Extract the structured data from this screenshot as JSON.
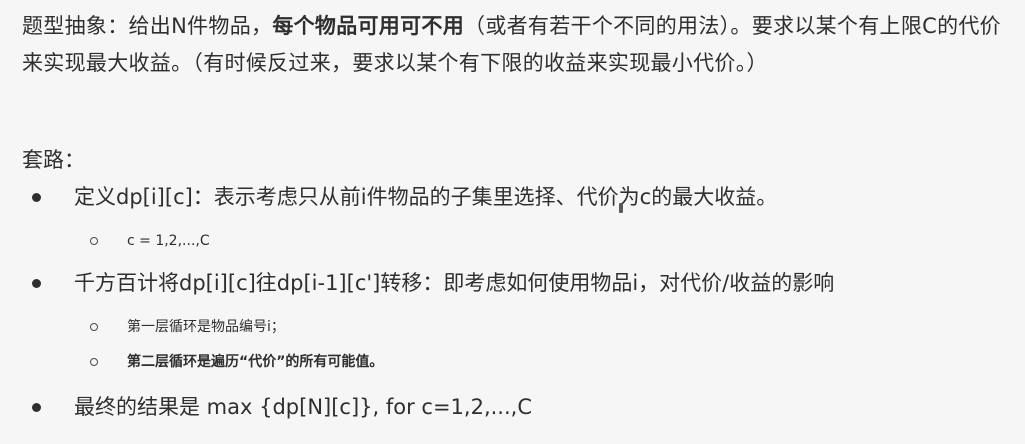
{
  "intro": {
    "part1": "题型抽象：给出N件物品，",
    "bold": "每个物品可用可不用",
    "part2": "（或者有若干个不同的用法）。要求以某个有上限C的代价来实现最大收益。（有时候反过来，要求以某个有下限的收益来实现最小代价。）"
  },
  "routine": {
    "heading": "套路：",
    "items": [
      {
        "text": "定义dp[i][c]：表示考虑只从前i件物品的子集里选择、代价为c的最大收益。",
        "subs": [
          {
            "text": "c = 1,2,...,C",
            "bold": false
          }
        ]
      },
      {
        "text": "千方百计将dp[i][c]往dp[i-1][c']转移：即考虑如何使用物品i，对代价/收益的影响",
        "subs": [
          {
            "text": "第一层循环是物品编号i；",
            "bold": false
          },
          {
            "text": "第二层循环是遍历“代价”的所有可能值。",
            "bold": true
          }
        ]
      },
      {
        "text": "最终的结果是 max {dp[N][c]}, for c=1,2,...,C",
        "subs": []
      }
    ]
  }
}
